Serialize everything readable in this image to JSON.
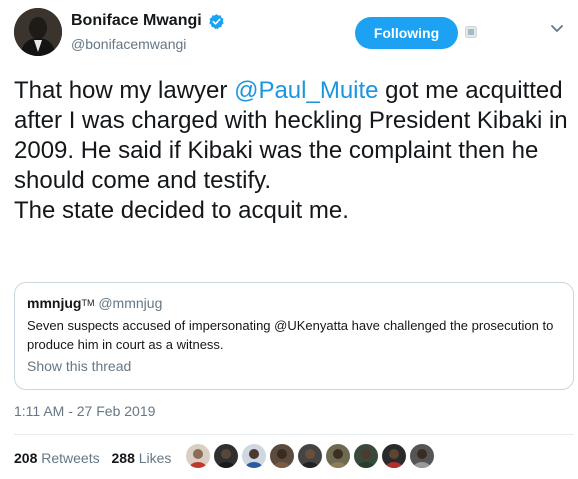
{
  "author": {
    "name": "Boniface Mwangi",
    "handle": "@bonifacemwangi",
    "verified": true
  },
  "header": {
    "follow_label": "Following"
  },
  "tweet": {
    "line1_pre": "That how my lawyer ",
    "mention": "@Paul_Muite",
    "line1_post": " got me acquitted after I was charged with heckling President Kibaki in 2009. He said if Kibaki was the complaint then he should come and testify.\nThe state decided to acquit me."
  },
  "quoted": {
    "name": "mmnjug",
    "tm": "TM",
    "handle": "@mmnjug",
    "text": "Seven suspects accused of impersonating @UKenyatta have challenged the prosecution to produce him in court as a witness.",
    "thread_link": "Show this thread"
  },
  "timestamp": "1:11 AM - 27 Feb 2019",
  "stats": {
    "retweets_count": "208",
    "retweets_label": "Retweets",
    "likes_count": "288",
    "likes_label": "Likes"
  },
  "colors": {
    "accent": "#1da1f2",
    "link": "#1b95e0",
    "muted": "#657786"
  },
  "likers": [
    "liker-avatar-1",
    "liker-avatar-2",
    "liker-avatar-3",
    "liker-avatar-4",
    "liker-avatar-5",
    "liker-avatar-6",
    "liker-avatar-7",
    "liker-avatar-8",
    "liker-avatar-9"
  ]
}
